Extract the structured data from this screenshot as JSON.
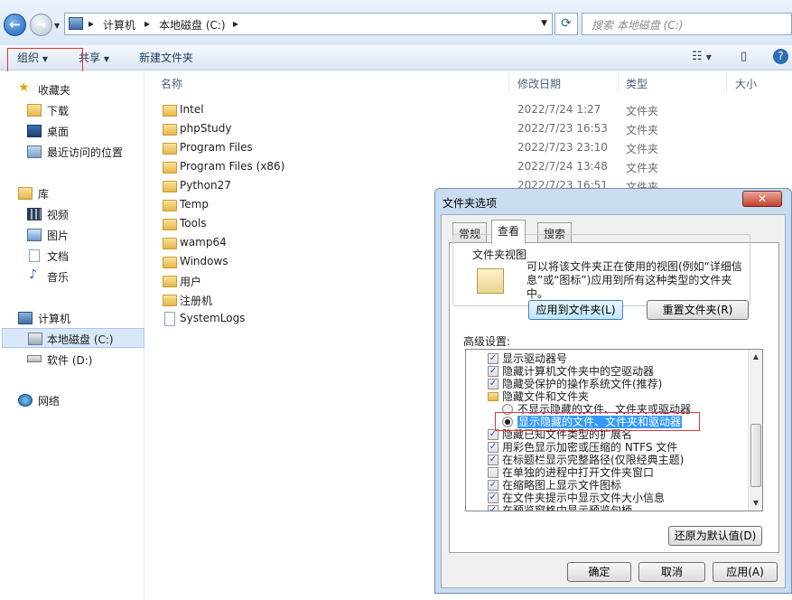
{
  "address": {
    "crumbs": [
      "计算机",
      "本地磁盘 (C:)"
    ],
    "search_placeholder": "搜索 本地磁盘 (C:)"
  },
  "toolbar": {
    "organize": "组织",
    "share": "共享",
    "new_folder": "新建文件夹"
  },
  "sidebar": {
    "favorites": "收藏夹",
    "downloads": "下载",
    "desktop": "桌面",
    "recent": "最近访问的位置",
    "library": "库",
    "videos": "视频",
    "pictures": "图片",
    "documents": "文档",
    "music": "音乐",
    "computer": "计算机",
    "local_disk": "本地磁盘 (C:)",
    "software": "软件 (D:)",
    "network": "网络"
  },
  "columns": {
    "name": "名称",
    "modified": "修改日期",
    "type": "类型",
    "size": "大小"
  },
  "files": [
    {
      "name": "Intel",
      "date": "2022/7/24 1:27",
      "type": "文件夹"
    },
    {
      "name": "phpStudy",
      "date": "2022/7/23 16:53",
      "type": "文件夹"
    },
    {
      "name": "Program Files",
      "date": "2022/7/23 23:10",
      "type": "文件夹"
    },
    {
      "name": "Program Files (x86)",
      "date": "2022/7/24 13:48",
      "type": "文件夹"
    },
    {
      "name": "Python27",
      "date": "2022/7/23 16:51",
      "type": "文件夹"
    },
    {
      "name": "Temp",
      "date": "",
      "type": ""
    },
    {
      "name": "Tools",
      "date": "",
      "type": ""
    },
    {
      "name": "wamp64",
      "date": "",
      "type": ""
    },
    {
      "name": "Windows",
      "date": "",
      "type": ""
    },
    {
      "name": "用户",
      "date": "",
      "type": ""
    },
    {
      "name": "注册机",
      "date": "",
      "type": ""
    },
    {
      "name": "SystemLogs",
      "date": "",
      "type": ""
    }
  ],
  "dialog": {
    "title": "文件夹选项",
    "close": "✕",
    "tabs": [
      "常规",
      "查看",
      "搜索"
    ],
    "folder_views_label": "文件夹视图",
    "folder_views_text": "可以将该文件夹正在使用的视图(例如“详细信息”或“图标”)应用到所有这种类型的文件夹中。",
    "apply_button": "应用到文件夹(L)",
    "reset_button": "重置文件夹(R)",
    "advanced_label": "高级设置:",
    "items": [
      {
        "kind": "check",
        "checked": true,
        "text": "显示驱动器号"
      },
      {
        "kind": "check",
        "checked": true,
        "text": "隐藏计算机文件夹中的空驱动器"
      },
      {
        "kind": "check",
        "checked": true,
        "text": "隐藏受保护的操作系统文件(推荐)"
      },
      {
        "kind": "folder",
        "text": "隐藏文件和文件夹"
      },
      {
        "kind": "radio",
        "checked": false,
        "text": "不显示隐藏的文件、文件夹或驱动器"
      },
      {
        "kind": "radio",
        "checked": true,
        "text": "显示隐藏的文件、文件夹和驱动器"
      },
      {
        "kind": "check",
        "checked": true,
        "text": "隐藏已知文件类型的扩展名"
      },
      {
        "kind": "check",
        "checked": true,
        "text": "用彩色显示加密或压缩的 NTFS 文件"
      },
      {
        "kind": "check",
        "checked": true,
        "text": "在标题栏显示完整路径(仅限经典主题)"
      },
      {
        "kind": "check",
        "checked": false,
        "text": "在单独的进程中打开文件夹窗口"
      },
      {
        "kind": "check",
        "checked": true,
        "text": "在缩略图上显示文件图标"
      },
      {
        "kind": "check",
        "checked": true,
        "text": "在文件夹提示中显示文件大小信息"
      },
      {
        "kind": "check",
        "checked": true,
        "text": "在预览窗格中显示预览句柄"
      }
    ],
    "restore_button": "还原为默认值(D)",
    "ok_button": "确定",
    "cancel_button": "取消",
    "apply2_button": "应用(A)"
  }
}
